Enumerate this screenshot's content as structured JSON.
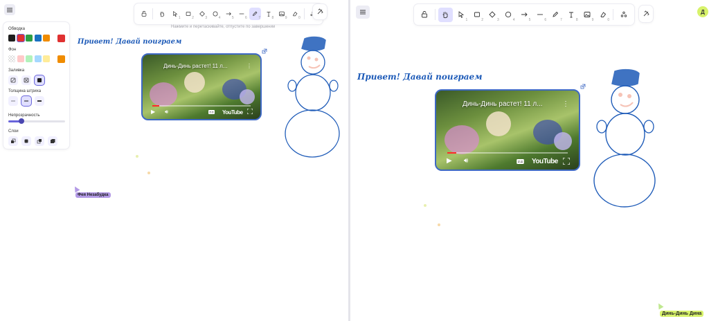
{
  "colors": {
    "accent": "#6965db",
    "accent_light": "#e0dfff",
    "drawing_blue": "#1e5bb8",
    "collab_purple": "#b39ae6",
    "collab_green": "#d7f26b"
  },
  "toolbar": {
    "tools": [
      {
        "icon": "lock-icon",
        "shortcut": ""
      },
      {
        "icon": "hand-icon",
        "shortcut": ""
      },
      {
        "icon": "selection-icon",
        "shortcut": "1"
      },
      {
        "icon": "rectangle-icon",
        "shortcut": "2"
      },
      {
        "icon": "diamond-icon",
        "shortcut": "3"
      },
      {
        "icon": "ellipse-icon",
        "shortcut": "4"
      },
      {
        "icon": "arrow-icon",
        "shortcut": "5"
      },
      {
        "icon": "line-icon",
        "shortcut": "6"
      },
      {
        "icon": "pencil-icon",
        "shortcut": "7"
      },
      {
        "icon": "text-icon",
        "shortcut": "8"
      },
      {
        "icon": "image-icon",
        "shortcut": "9"
      },
      {
        "icon": "eraser-icon",
        "shortcut": "0"
      },
      {
        "icon": "more-tools-icon",
        "shortcut": ""
      }
    ],
    "left_active": "pencil-icon",
    "right_active": "hand-icon"
  },
  "left": {
    "hint": "Нажмите и перетаскивайте, отпустите по завершении",
    "props": {
      "stroke_label": "Обводка",
      "stroke_colors": [
        "#1e1e1e",
        "#e03131",
        "#2f9e44",
        "#1971c2",
        "#f08c00"
      ],
      "stroke_current": "#e03131",
      "background_label": "Фон",
      "background_colors": [
        "transparent",
        "#ffc9c9",
        "#b2f2bb",
        "#a5d8ff",
        "#ffec99"
      ],
      "background_current": "#f08c00",
      "fill_label": "Заливка",
      "stroke_width_label": "Толщина штриха",
      "opacity_label": "Непрозрачность",
      "opacity_value": 0.23,
      "layers_label": "Слои"
    },
    "heading": "Привет! Давай поиграем",
    "video": {
      "title": "Динь-Динь растет! 11 л...",
      "brand": "YouTube",
      "progress": 0.07
    },
    "collaborator": "Фея Незабудка"
  },
  "right": {
    "heading": "Привет! Давай поиграем",
    "video": {
      "title": "Динь-Динь растет! 11 л...",
      "brand": "YouTube",
      "progress": 0.07
    },
    "avatar_initial": "Д",
    "collaborator": "Динь-Динь Дина"
  }
}
